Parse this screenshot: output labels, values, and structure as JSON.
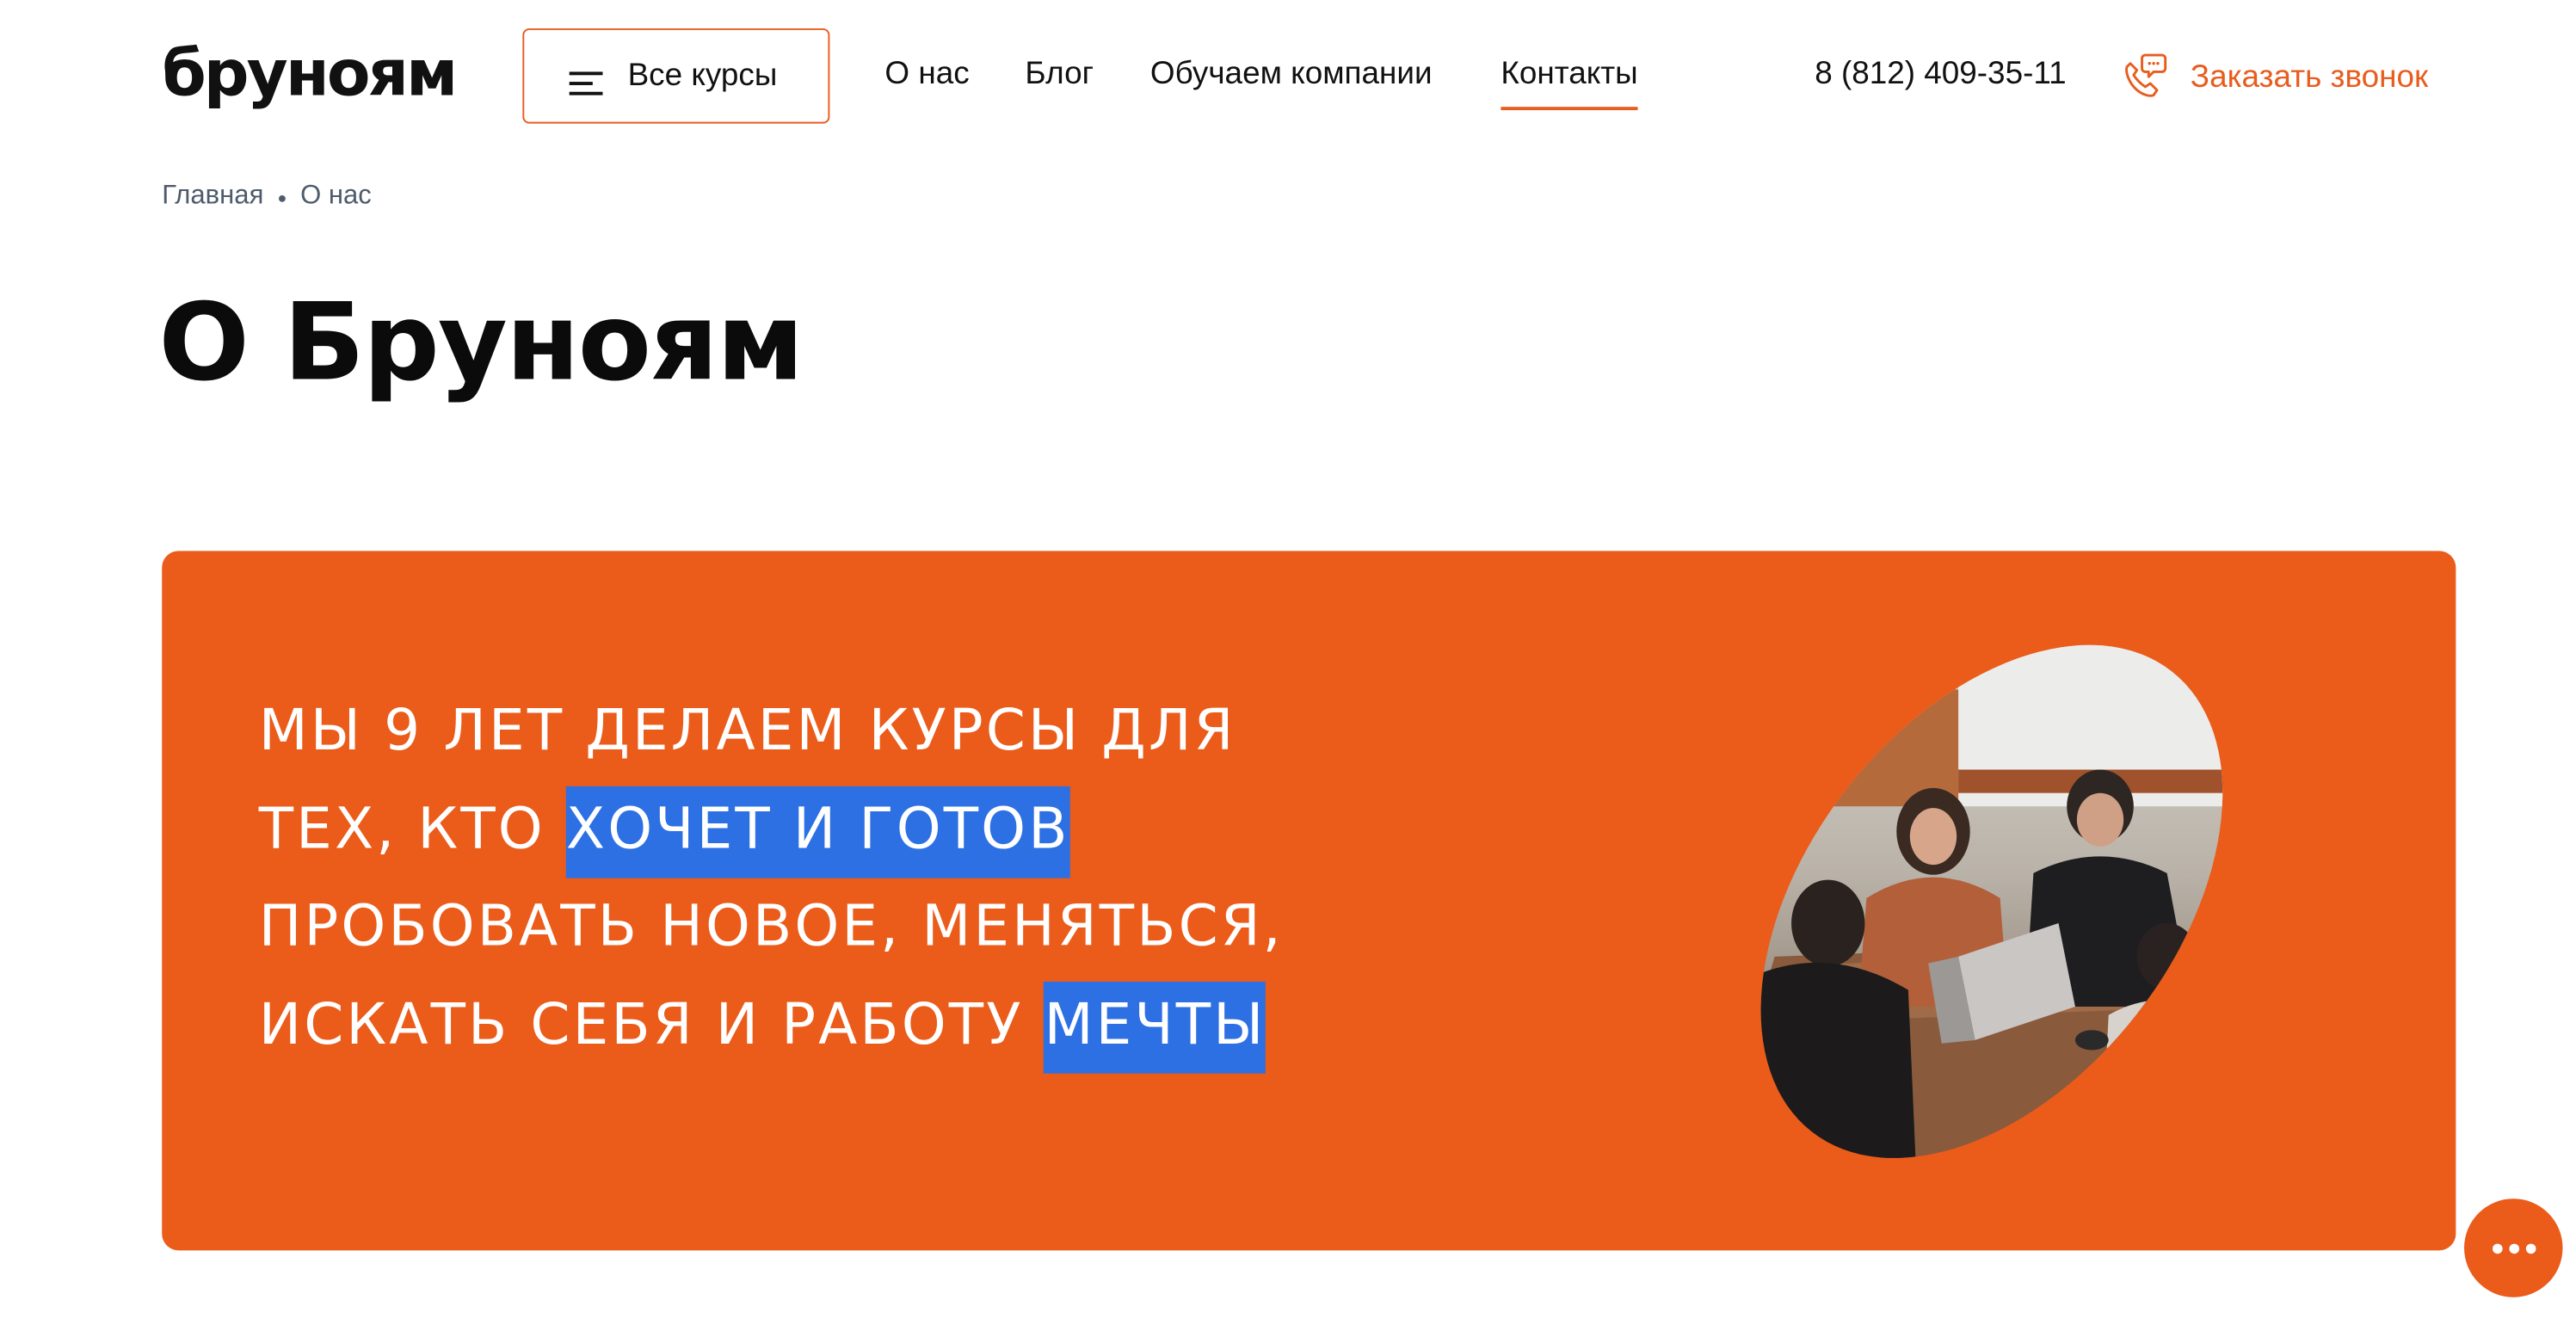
{
  "header": {
    "logo_text": "бруноям",
    "courses_button_label": "Все курсы",
    "nav": [
      {
        "label": "О нас",
        "active": false
      },
      {
        "label": "Блог",
        "active": false
      },
      {
        "label": "Обучаем компании",
        "active": false
      },
      {
        "label": "Контакты",
        "active": true
      }
    ],
    "phone": "8 (812) 409-35-11",
    "callback_label": "Заказать звонок",
    "icons": {
      "menu": "burger-menu-icon",
      "callback": "phone-chat-icon"
    }
  },
  "breadcrumb": {
    "items": [
      "Главная",
      "О нас"
    ]
  },
  "page_title": "О Бруноям",
  "hero": {
    "line1": "МЫ 9 ЛЕТ ДЕЛАЕМ КУРСЫ ДЛЯ",
    "line2_plain": "ТЕХ, КТО",
    "line2_highlight": "ХОЧЕТ И ГОТОВ",
    "line3": "ПРОБОВАТЬ НОВОЕ, МЕНЯТЬСЯ,",
    "line4_plain": "ИСКАТЬ СЕБЯ И РАБОТУ",
    "line4_highlight": "МЕЧТЫ",
    "photo": "team-meeting-photo"
  },
  "chat_fab": {
    "icon": "more-dots-icon"
  },
  "colors": {
    "brand_orange": "#eb5b1a",
    "highlight_blue": "#2d70e4",
    "text_dark": "#111111",
    "breadcrumb_gray": "#4e5b6c"
  }
}
